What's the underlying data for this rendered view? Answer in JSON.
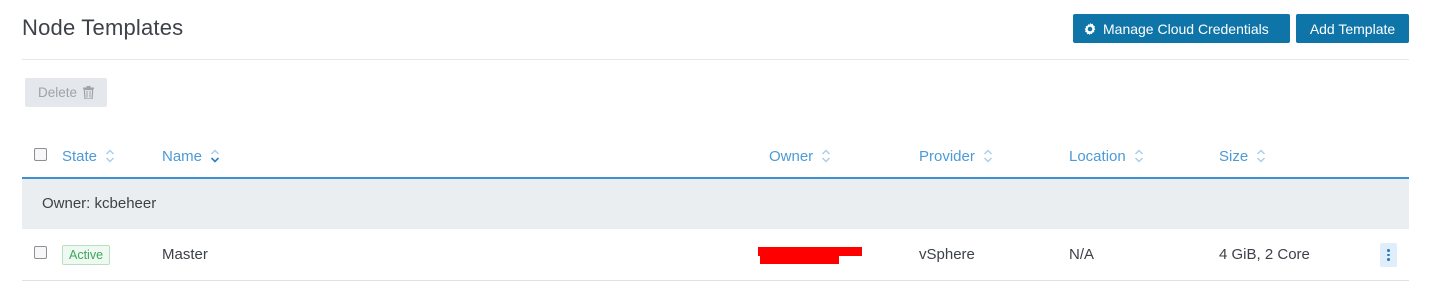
{
  "header": {
    "title": "Node Templates",
    "manage_credentials_label": "Manage Cloud Credentials",
    "add_template_label": "Add Template"
  },
  "toolbar": {
    "delete_label": "Delete"
  },
  "table": {
    "columns": [
      "State",
      "Name",
      "Owner",
      "Provider",
      "Location",
      "Size"
    ],
    "sorted_column": "Name",
    "groups": [
      {
        "label": "Owner: kcbeheer",
        "rows": [
          {
            "state": "Active",
            "name": "Master",
            "owner": "",
            "provider": "vSphere",
            "location": "N/A",
            "size": "4 GiB, 2 Core"
          }
        ]
      }
    ]
  },
  "colors": {
    "primary": "#0f75a8",
    "link": "#4c9ad6",
    "active_badge": "#3ea65a",
    "redaction": "#ff0000"
  },
  "icons": [
    "gear-icon",
    "trash-icon",
    "sort-icon",
    "more-actions-icon"
  ]
}
